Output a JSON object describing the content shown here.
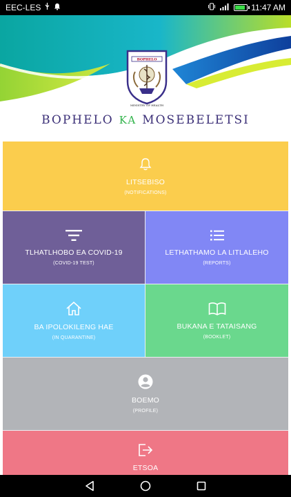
{
  "status_bar": {
    "carrier": "EEC-LES",
    "time": "11:47 AM",
    "battery_level": 0.85,
    "icons": [
      "usb-icon",
      "notification-icon",
      "vibrate-icon",
      "signal-icon",
      "battery-icon"
    ]
  },
  "header": {
    "logo_text_top": "BOPHELO",
    "logo_text_bottom": "MINISTRY OF HEALTH",
    "title_left": "BOPHELO",
    "title_mid": "KA",
    "title_right": "MOSEBELETSI"
  },
  "colors": {
    "title": "#3b2f77",
    "title_mid": "#2fb349",
    "notifications": "#fbcd4d",
    "covid_test": "#6f5f98",
    "reports": "#8187f5",
    "quarantine": "#6fd0fa",
    "booklet": "#6ad88d",
    "profile": "#b2b4b8",
    "logout": "#ef7786"
  },
  "tiles": {
    "notifications": {
      "label": "LITSEBISO",
      "sub": "(NOTIFICATIONS)",
      "icon": "bell-icon"
    },
    "covid_test": {
      "label": "TLHATLHOBO EA COVID-19",
      "sub": "(COVID-19 TEST)",
      "icon": "filter-icon"
    },
    "reports": {
      "label": "LETHATHAMO LA LITLALEHO",
      "sub": "(REPORTS)",
      "icon": "list-icon"
    },
    "quarantine": {
      "label": "BA IPOLOKILENG HAE",
      "sub": "(IN QUARANTINE)",
      "icon": "home-icon"
    },
    "booklet": {
      "label": "BUKANA E TATAISANG",
      "sub": "(BOOKLET)",
      "icon": "book-icon"
    },
    "profile": {
      "label": "BOEMO",
      "sub": "(PROFILE)",
      "icon": "account-circle-icon"
    },
    "logout": {
      "label": "ETSOA",
      "icon": "logout-icon"
    }
  },
  "nav_bar": {
    "buttons": [
      "back-icon",
      "home-circle-icon",
      "recents-icon"
    ]
  }
}
